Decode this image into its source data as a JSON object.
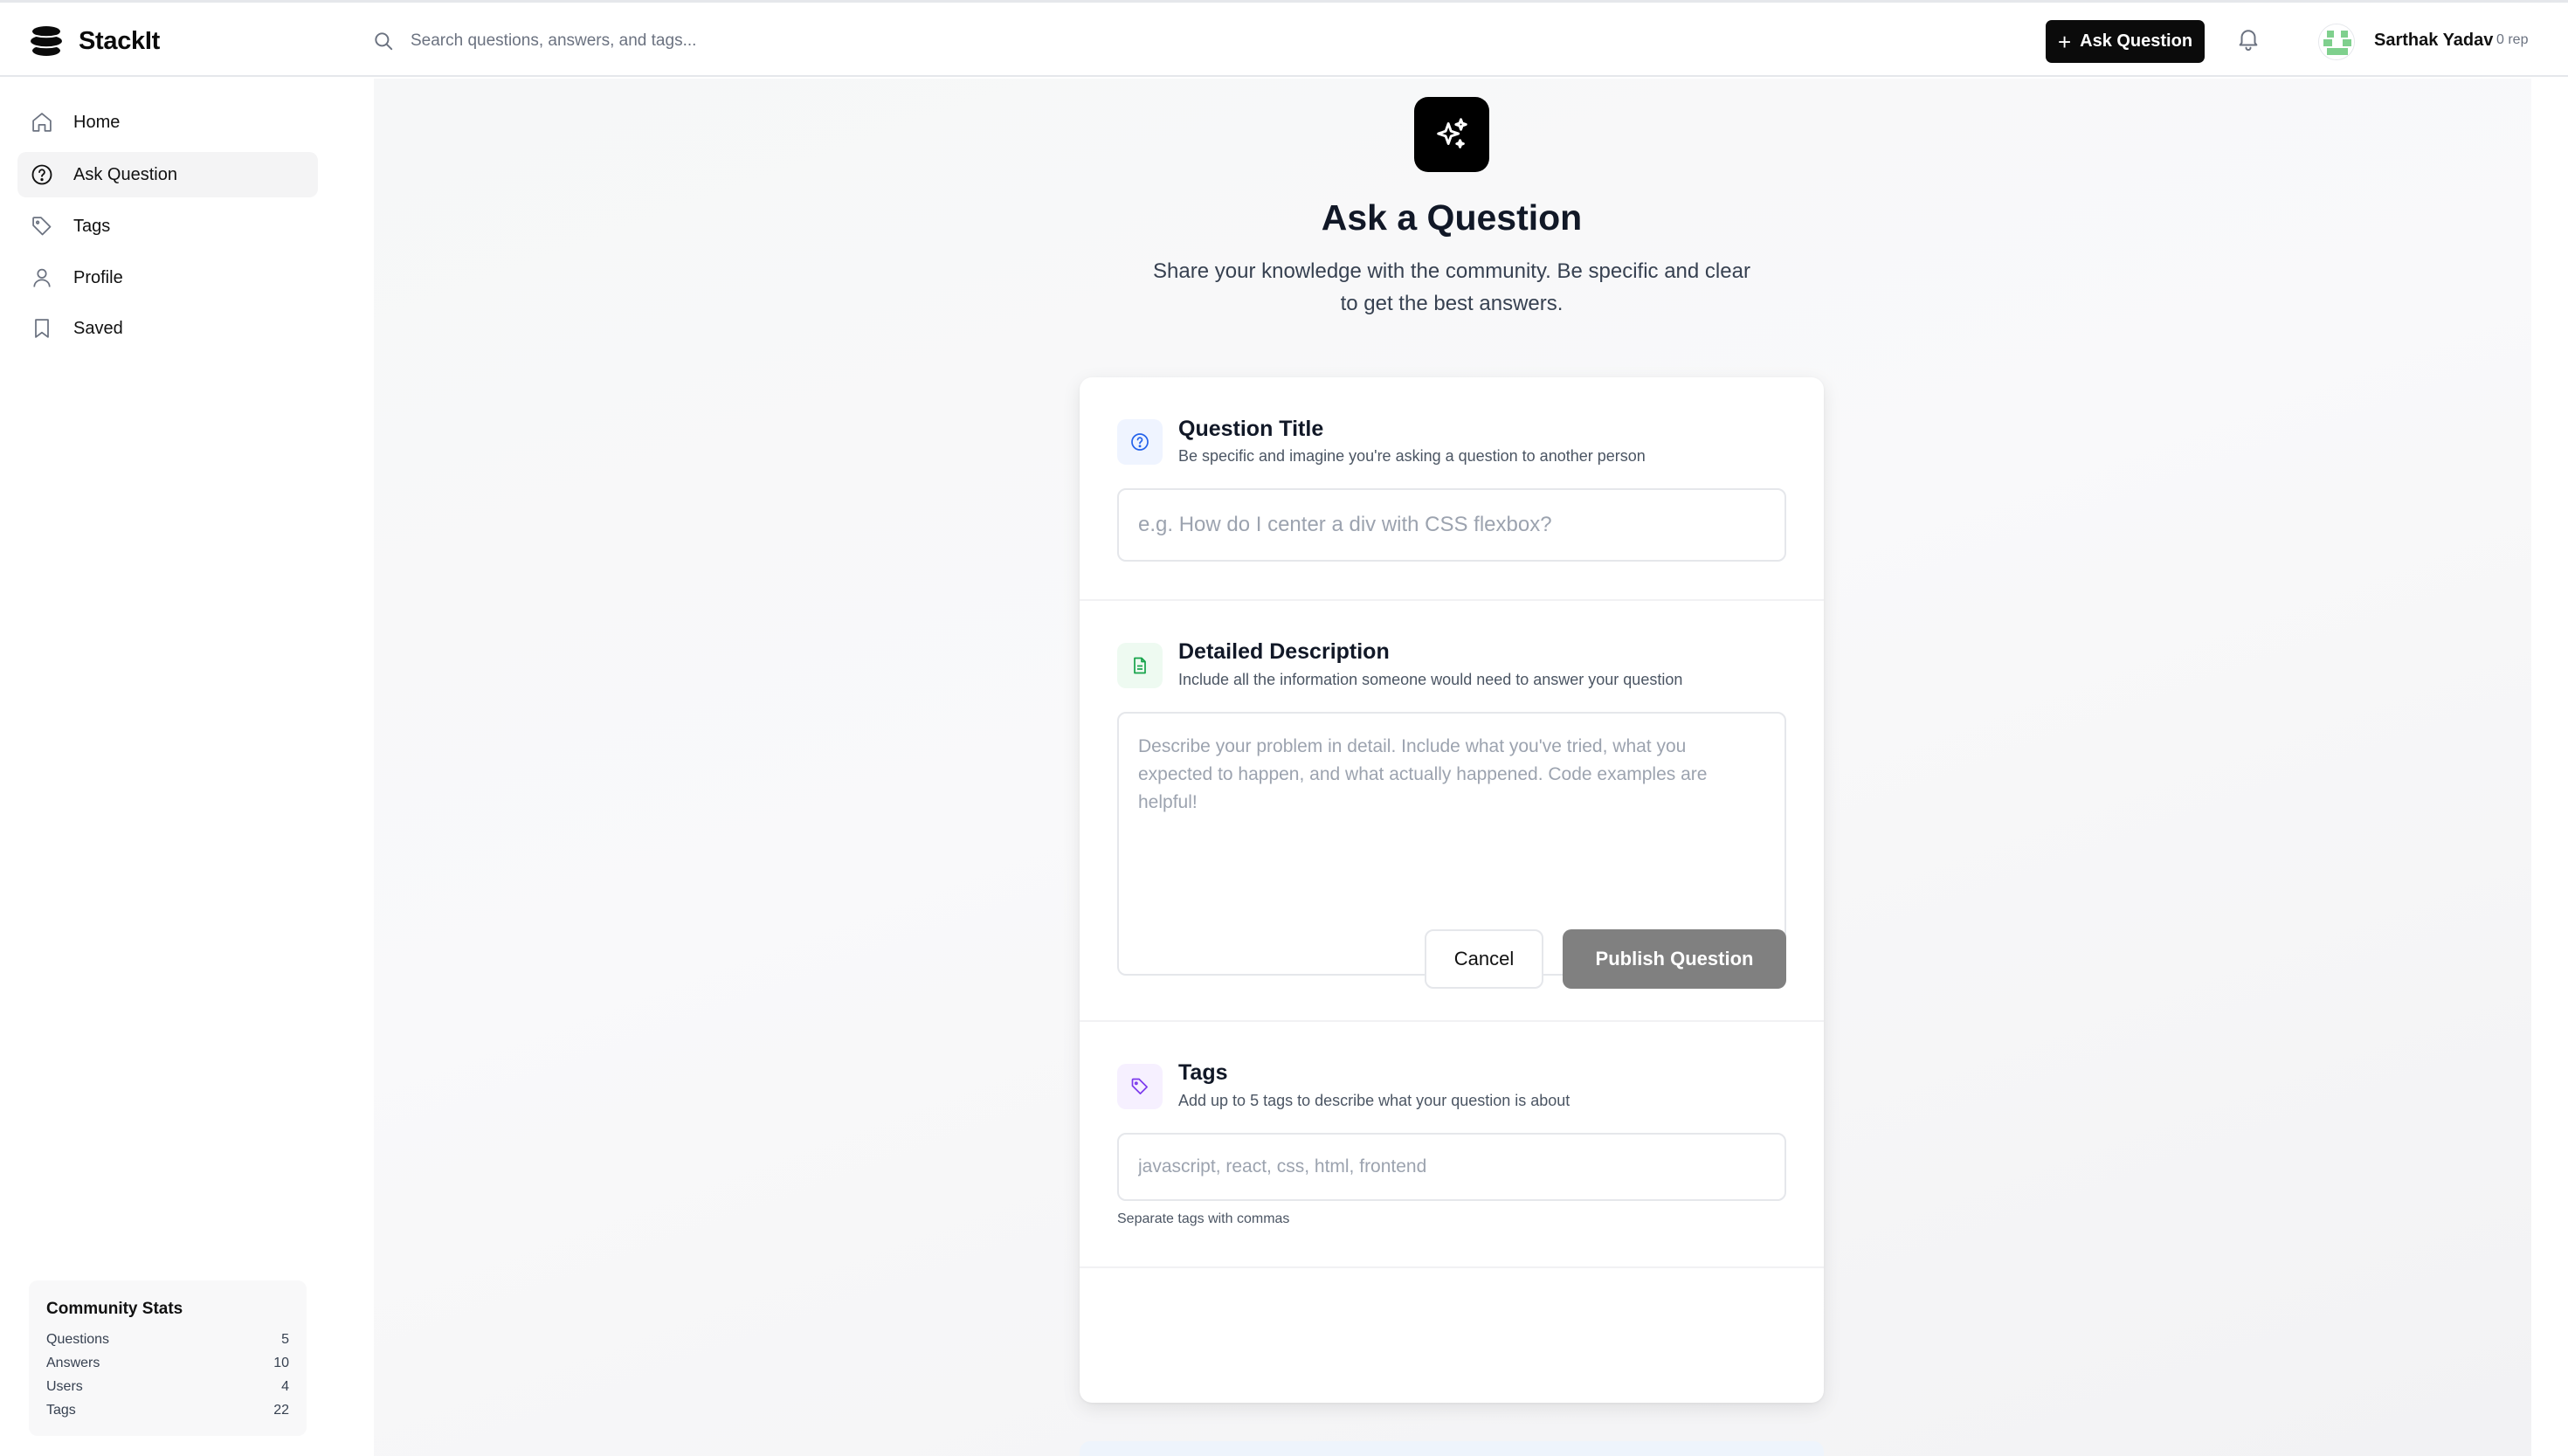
{
  "app": {
    "name": "StackIt"
  },
  "search": {
    "placeholder": "Search questions, answers, and tags..."
  },
  "header": {
    "ask_label": "Ask Question",
    "user_name": "Sarthak Yadav",
    "user_rep": "0 rep",
    "icons": [
      "stack-logo-icon",
      "search-icon",
      "plus-icon",
      "bell-icon",
      "avatar"
    ]
  },
  "sidebar": {
    "items": [
      {
        "label": "Home",
        "icon": "home-icon"
      },
      {
        "label": "Ask Question",
        "icon": "question-circle-icon",
        "active": true
      },
      {
        "label": "Tags",
        "icon": "tag-icon"
      },
      {
        "label": "Profile",
        "icon": "user-icon"
      },
      {
        "label": "Saved",
        "icon": "bookmark-icon"
      }
    ],
    "stats": {
      "title": "Community Stats",
      "rows": [
        {
          "label": "Questions",
          "value": "5"
        },
        {
          "label": "Answers",
          "value": "10"
        },
        {
          "label": "Users",
          "value": "4"
        },
        {
          "label": "Tags",
          "value": "22"
        }
      ]
    }
  },
  "page": {
    "icon": "sparkles-icon",
    "title": "Ask a Question",
    "subtitle": "Share your knowledge with the community. Be specific and clear to get the best answers."
  },
  "form": {
    "title_section": {
      "title": "Question Title",
      "description": "Be specific and imagine you're asking a question to another person",
      "placeholder": "e.g. How do I center a div with CSS flexbox?",
      "value": ""
    },
    "description_section": {
      "title": "Detailed Description",
      "description": "Include all the information someone would need to answer your question",
      "placeholder": "Describe your problem in detail. Include what you've tried, what you expected to happen, and what actually happened. Code examples are helpful!",
      "value": ""
    },
    "tags_section": {
      "title": "Tags",
      "description": "Add up to 5 tags to describe what your question is about",
      "placeholder": "javascript, react, css, html, frontend",
      "value": "",
      "hint": "Separate tags with commas"
    },
    "cancel_label": "Cancel",
    "publish_label": "Publish Question"
  },
  "colors": {
    "accent": "#0b0b0b",
    "publish_disabled": "#808080",
    "title_icon": "#2563eb",
    "description_icon": "#16a34a",
    "tags_icon": "#7c3aed"
  }
}
